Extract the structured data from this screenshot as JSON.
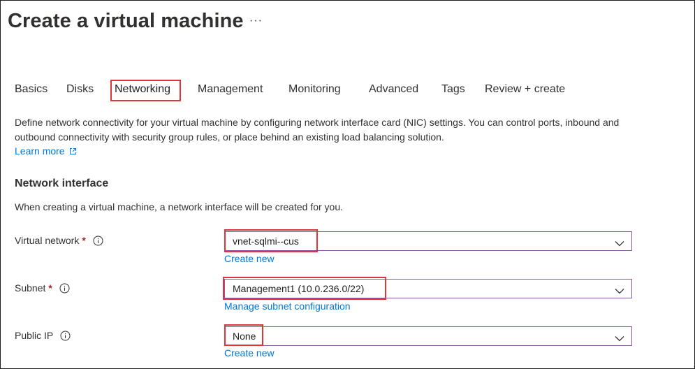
{
  "page": {
    "title": "Create a virtual machine",
    "more_label": "···"
  },
  "tabs": [
    {
      "label": "Basics"
    },
    {
      "label": "Disks"
    },
    {
      "label": "Networking",
      "active": true
    },
    {
      "label": "Management"
    },
    {
      "label": "Monitoring"
    },
    {
      "label": "Advanced"
    },
    {
      "label": "Tags"
    },
    {
      "label": "Review + create"
    }
  ],
  "description": {
    "text": "Define network connectivity for your virtual machine by configuring network interface card (NIC) settings. You can control ports, inbound and outbound connectivity with security group rules, or place behind an existing load balancing solution.",
    "learn_more": "Learn more"
  },
  "network_interface": {
    "heading": "Network interface",
    "note": "When creating a virtual machine, a network interface will be created for you.",
    "virtual_network": {
      "label": "Virtual network",
      "required": "*",
      "value": "vnet-sqlmi--cus",
      "link": "Create new"
    },
    "subnet": {
      "label": "Subnet",
      "required": "*",
      "value": "Management1 (10.0.236.0/22)",
      "link": "Manage subnet configuration"
    },
    "public_ip": {
      "label": "Public IP",
      "value": "None",
      "link": "Create new"
    }
  },
  "colors": {
    "accent_link": "#0078d4",
    "highlight": "#e0343a",
    "required": "#a4262c",
    "select_border": "#8a5a9e"
  },
  "icons": {
    "more": "ellipsis-icon",
    "external": "external-link-icon",
    "info": "info-icon",
    "dropdown": "chevron-down-icon"
  }
}
